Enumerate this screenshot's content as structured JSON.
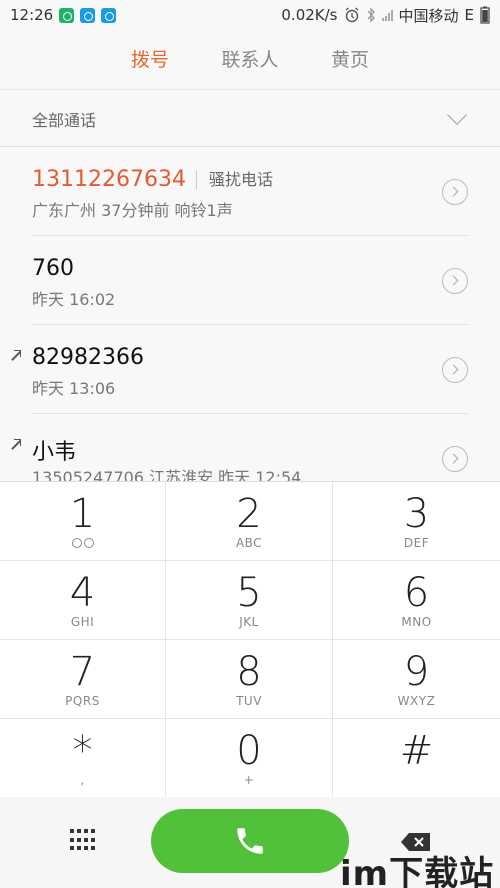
{
  "status": {
    "time": "12:26",
    "speed": "0.02K/s",
    "carrier": "中国移动",
    "network": "E"
  },
  "tabs": [
    {
      "label": "拨号",
      "active": true
    },
    {
      "label": "联系人",
      "active": false
    },
    {
      "label": "黄页",
      "active": false
    }
  ],
  "filter": {
    "label": "全部通话"
  },
  "calls": [
    {
      "name": "13112267634",
      "tag": "骚扰电话",
      "sub": "广东广州 37分钟前 响铃1声"
    },
    {
      "name": "760",
      "sub": "昨天 16:02"
    },
    {
      "name": "82982366",
      "sub": "昨天 13:06"
    },
    {
      "name": "小韦",
      "sub": "13505247706 江苏淮安 昨天 12:54"
    }
  ],
  "keys": [
    {
      "digit": "1",
      "letters": ""
    },
    {
      "digit": "2",
      "letters": "ABC"
    },
    {
      "digit": "3",
      "letters": "DEF"
    },
    {
      "digit": "4",
      "letters": "GHI"
    },
    {
      "digit": "5",
      "letters": "JKL"
    },
    {
      "digit": "6",
      "letters": "MNO"
    },
    {
      "digit": "7",
      "letters": "PQRS"
    },
    {
      "digit": "8",
      "letters": "TUV"
    },
    {
      "digit": "9",
      "letters": "WXYZ"
    },
    {
      "digit": "*",
      "letters": ","
    },
    {
      "digit": "0",
      "letters": "+"
    },
    {
      "digit": "#",
      "letters": ""
    }
  ],
  "watermark": "im下载站",
  "colors": {
    "accent": "#e8672c",
    "call_button": "#52c13a"
  }
}
